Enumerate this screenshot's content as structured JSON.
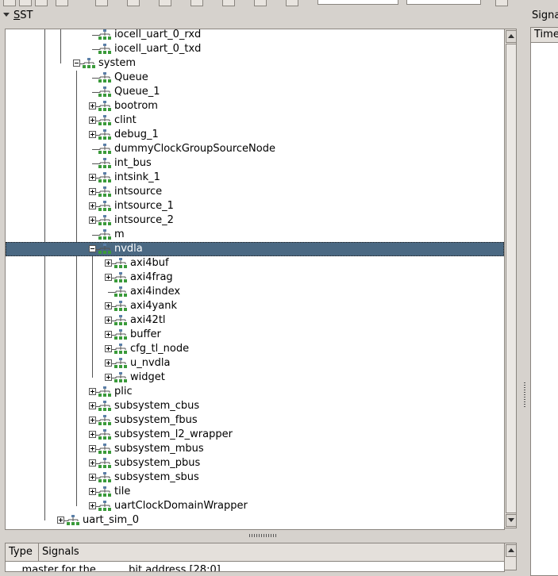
{
  "sst": {
    "title": "SST",
    "mnemonic": "S"
  },
  "right_panel": {
    "title": "Signa",
    "column_header": "Time"
  },
  "signals_table": {
    "headers": {
      "type": "Type",
      "signals": "Signals"
    },
    "first_row_text": "... master for the ... .... bit address [28:0]"
  },
  "tree": [
    {
      "label": "iocell_uart_0_rxd",
      "depth": 3,
      "expander": "none"
    },
    {
      "label": "iocell_uart_0_txd",
      "depth": 3,
      "expander": "none"
    },
    {
      "label": "system",
      "depth": 2,
      "expander": "minus"
    },
    {
      "label": "Queue",
      "depth": 3,
      "expander": "none"
    },
    {
      "label": "Queue_1",
      "depth": 3,
      "expander": "none"
    },
    {
      "label": "bootrom",
      "depth": 3,
      "expander": "plus"
    },
    {
      "label": "clint",
      "depth": 3,
      "expander": "plus"
    },
    {
      "label": "debug_1",
      "depth": 3,
      "expander": "plus"
    },
    {
      "label": "dummyClockGroupSourceNode",
      "depth": 3,
      "expander": "none"
    },
    {
      "label": "int_bus",
      "depth": 3,
      "expander": "none"
    },
    {
      "label": "intsink_1",
      "depth": 3,
      "expander": "plus"
    },
    {
      "label": "intsource",
      "depth": 3,
      "expander": "plus"
    },
    {
      "label": "intsource_1",
      "depth": 3,
      "expander": "plus"
    },
    {
      "label": "intsource_2",
      "depth": 3,
      "expander": "plus"
    },
    {
      "label": "m",
      "depth": 3,
      "expander": "none"
    },
    {
      "label": "nvdla",
      "depth": 3,
      "expander": "minus",
      "selected": true
    },
    {
      "label": "axi4buf",
      "depth": 4,
      "expander": "plus"
    },
    {
      "label": "axi4frag",
      "depth": 4,
      "expander": "plus"
    },
    {
      "label": "axi4index",
      "depth": 4,
      "expander": "none"
    },
    {
      "label": "axi4yank",
      "depth": 4,
      "expander": "plus"
    },
    {
      "label": "axi42tl",
      "depth": 4,
      "expander": "plus"
    },
    {
      "label": "buffer",
      "depth": 4,
      "expander": "plus"
    },
    {
      "label": "cfg_tl_node",
      "depth": 4,
      "expander": "plus"
    },
    {
      "label": "u_nvdla",
      "depth": 4,
      "expander": "plus"
    },
    {
      "label": "widget",
      "depth": 4,
      "expander": "plus"
    },
    {
      "label": "plic",
      "depth": 3,
      "expander": "plus"
    },
    {
      "label": "subsystem_cbus",
      "depth": 3,
      "expander": "plus"
    },
    {
      "label": "subsystem_fbus",
      "depth": 3,
      "expander": "plus"
    },
    {
      "label": "subsystem_l2_wrapper",
      "depth": 3,
      "expander": "plus"
    },
    {
      "label": "subsystem_mbus",
      "depth": 3,
      "expander": "plus"
    },
    {
      "label": "subsystem_pbus",
      "depth": 3,
      "expander": "plus"
    },
    {
      "label": "subsystem_sbus",
      "depth": 3,
      "expander": "plus"
    },
    {
      "label": "tile",
      "depth": 3,
      "expander": "plus"
    },
    {
      "label": "uartClockDomainWrapper",
      "depth": 3,
      "expander": "plus"
    },
    {
      "label": "uart_sim_0",
      "depth": 1,
      "expander": "plus"
    }
  ],
  "icons": {
    "node": "module-hierarchy-icon",
    "expand": "plus-box-icon",
    "collapse": "minus-box-icon"
  },
  "colors": {
    "selection": "#4b6983",
    "node_icon_green": "#3a9a3a",
    "node_icon_blue": "#5a7fa8"
  }
}
